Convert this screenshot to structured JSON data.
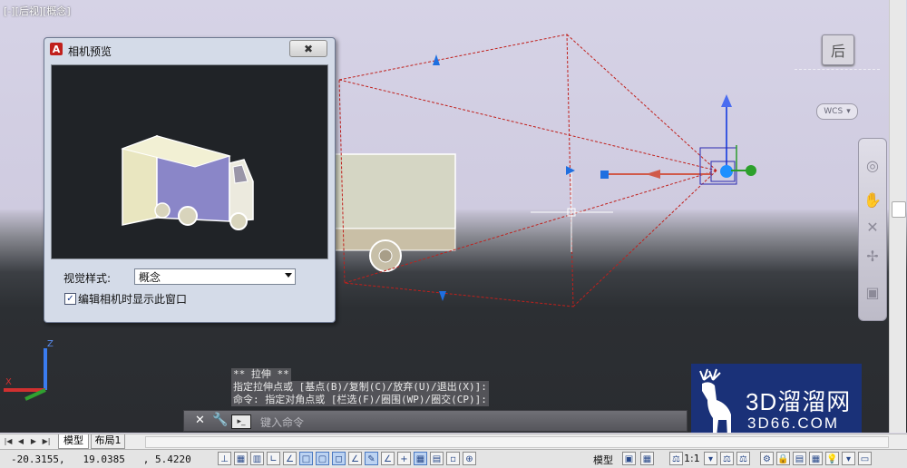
{
  "viewport": {
    "view_label": "[-][后视][概念]",
    "viewcube_face": "后",
    "wcs_label": "WCS",
    "bg_top": "#d6d3e6",
    "bg_bottom": "#2a2c30"
  },
  "dialog": {
    "title": "相机预览",
    "close_label": "✖",
    "visual_style_label": "视觉样式:",
    "visual_style_value": "概念",
    "checkbox_checked": true,
    "checkbox_label": "编辑相机时显示此窗口"
  },
  "command": {
    "history": [
      "** 拉伸 **",
      "指定拉伸点或 [基点(B)/复制(C)/放弃(U)/退出(X)]:",
      "命令: 指定对角点或 [栏选(F)/圈围(WP)/圈交(CP)]:"
    ],
    "input_placeholder": "键入命令"
  },
  "tabs": {
    "model": "模型",
    "layout1": "布局1"
  },
  "status": {
    "coord_x": "-20.3155,",
    "coord_y": "19.0385",
    "coord_z": ", 5.4220",
    "model_label": "模型",
    "scale_label": "1:1"
  },
  "watermark": {
    "brand": "3D溜溜网",
    "domain": "3D66.COM"
  },
  "colors": {
    "frustum": "#c0201c",
    "camera_blue": "#1f6fe0",
    "dialog_bg": "#d4dbe8",
    "watermark_bg": "#1a3178"
  },
  "icons": [
    "autocad-logo-icon",
    "close-icon",
    "chevron-down-icon",
    "checkbox-icon",
    "wrench-icon",
    "prompt-icon",
    "hand-icon",
    "orbit-icon",
    "zoom-icon",
    "watermark-deer-icon"
  ]
}
